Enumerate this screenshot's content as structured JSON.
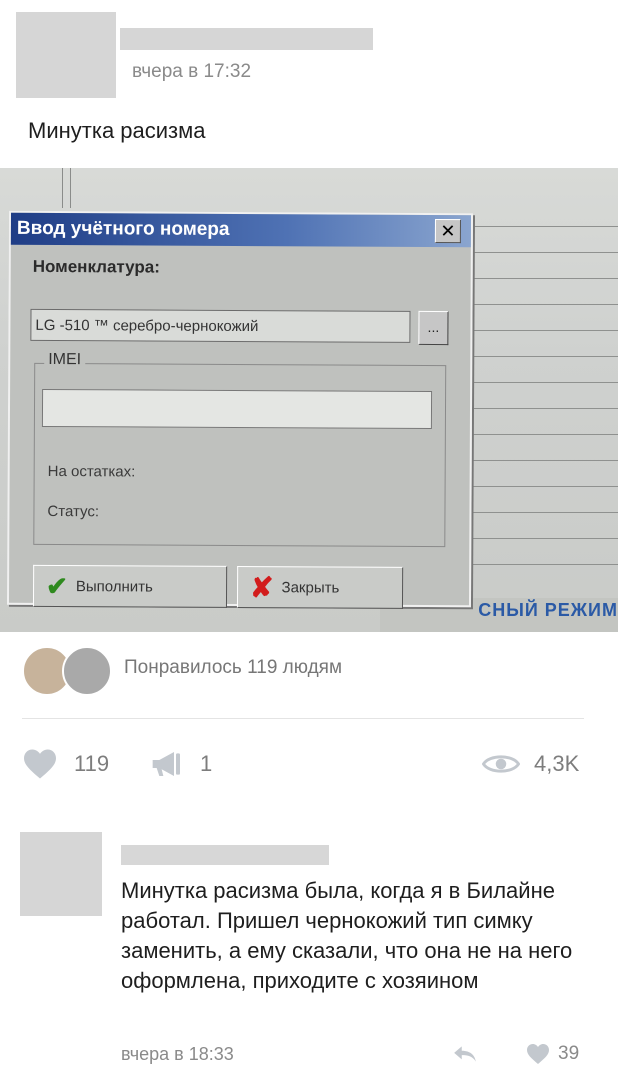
{
  "post": {
    "time": "вчера в 17:32",
    "text": "Минутка расизма"
  },
  "photo": {
    "dialog_title": "Ввод учётного номера",
    "nomenclature_label": "Номенклатура:",
    "nomenclature_value": "LG -510 ™ серебро-чернокожий",
    "browse_button": "...",
    "imei_label": "IMEI",
    "on_stock_label": "На остатках:",
    "status_label": "Статус:",
    "execute_button": "Выполнить",
    "close_button": "Закрыть",
    "close_glyph": "✕",
    "background_text": "СНЫЙ РЕЖИМ"
  },
  "likes_summary": {
    "text": "Понравилось 119 людям"
  },
  "actions": {
    "likes_count": "119",
    "shares_count": "1",
    "views_count": "4,3K",
    "icons": [
      "heart-icon",
      "megaphone-icon",
      "eye-icon"
    ]
  },
  "comment": {
    "text": "Минутка расизма была, когда я в Билайне работал. Пришел чернокожий тип симку заменить, а ему сказали, что она не на него оформлена, приходите с хозяином",
    "time": "вчера в 18:33",
    "likes_count": "39"
  },
  "colors": {
    "muted_text": "#8a8a8a",
    "placeholder_gray": "#d6d6d6",
    "icon_gray": "#c3c8ce",
    "dialog_title_blue": "#1f3d86"
  }
}
